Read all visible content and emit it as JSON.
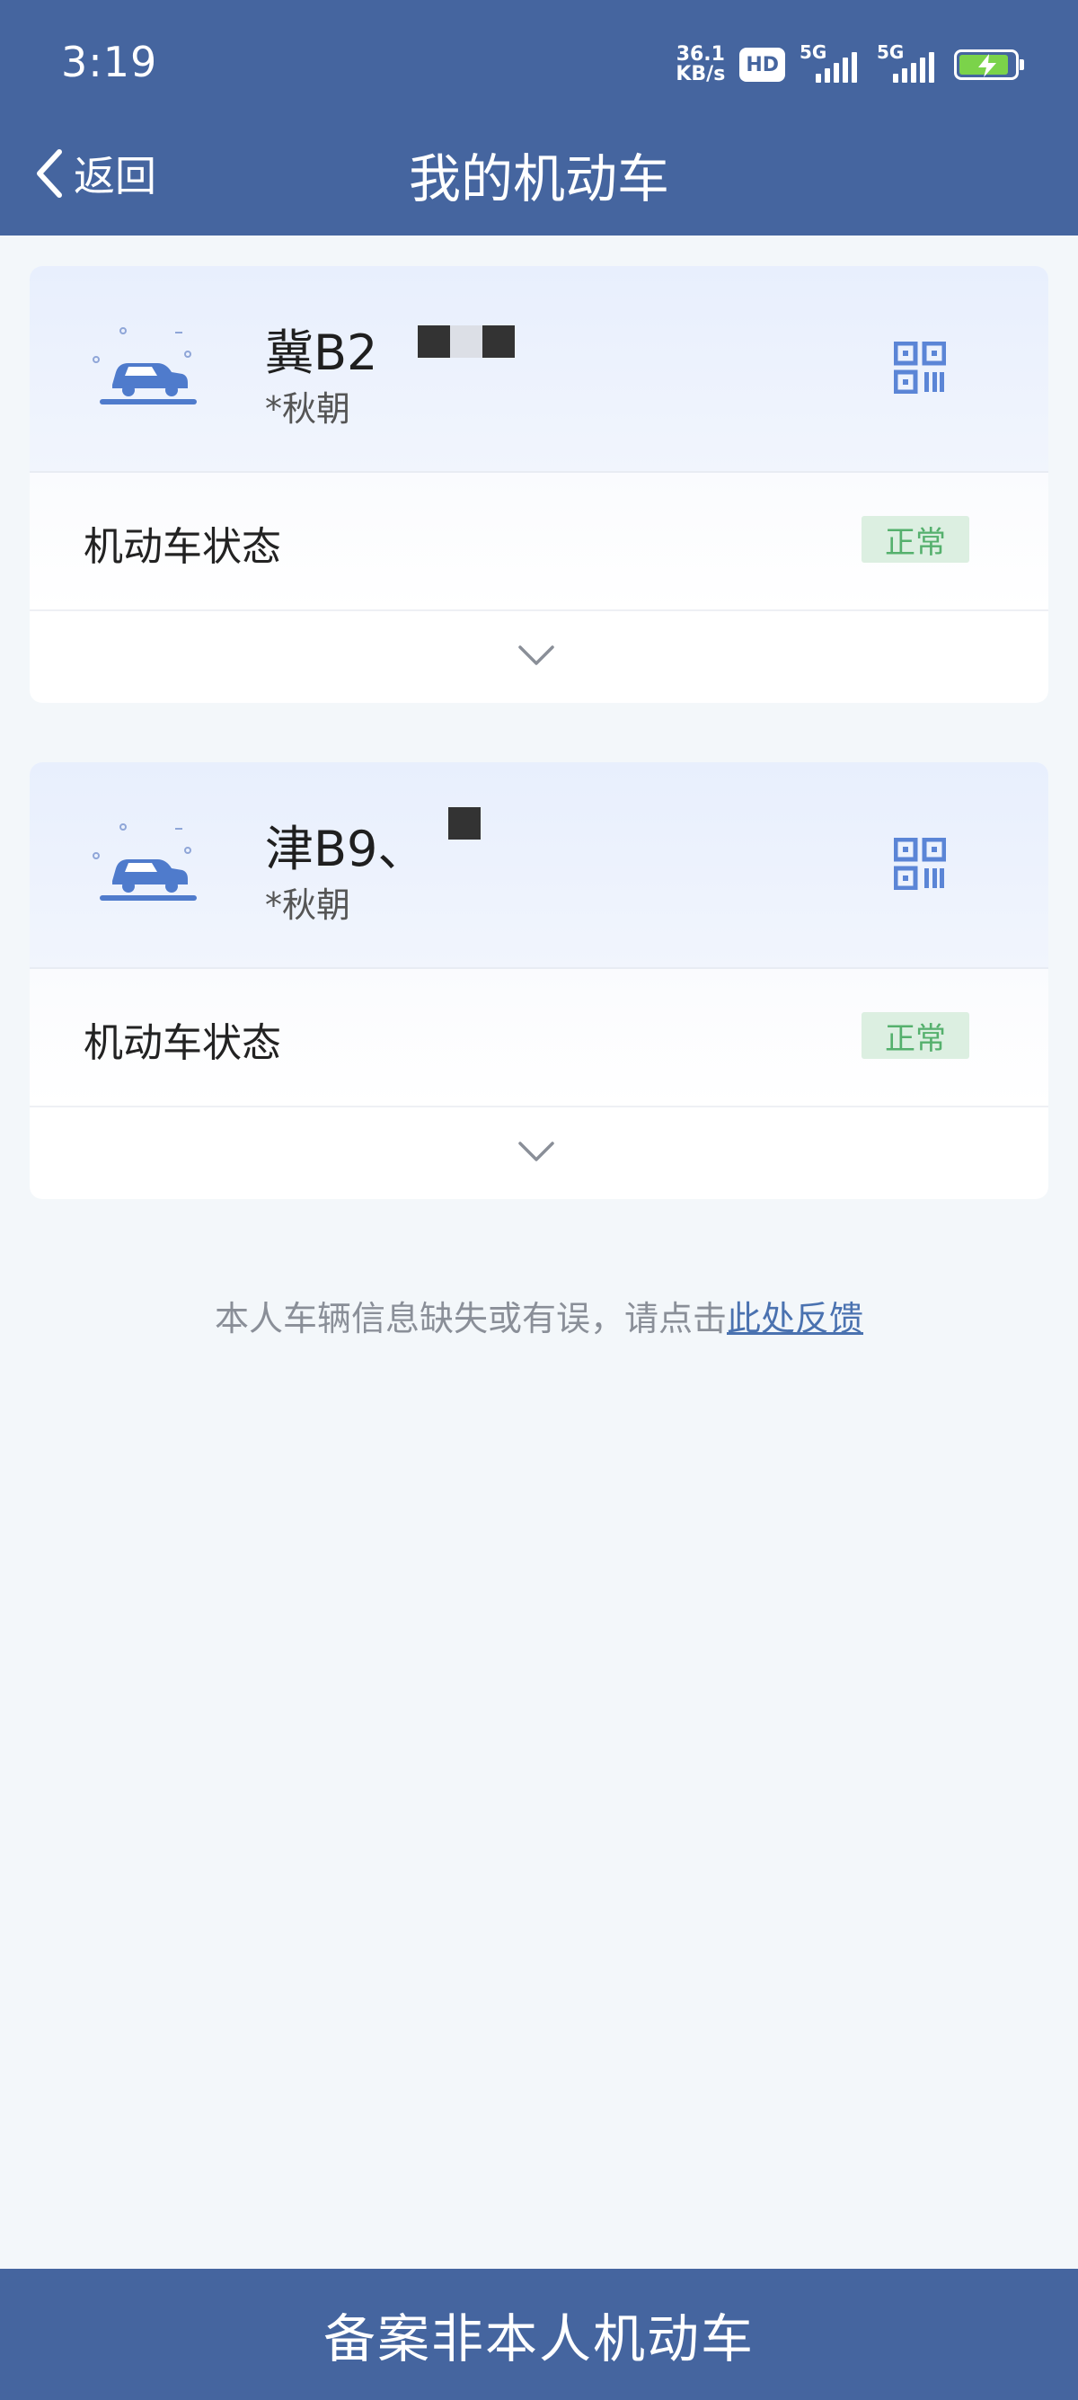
{
  "status_bar": {
    "time": "3:19",
    "net_speed_value": "36.1",
    "net_speed_unit": "KB/s",
    "hd_label": "HD",
    "signal1_label": "5G",
    "signal2_label": "5G",
    "battery_level": 0.9
  },
  "nav": {
    "back_label": "返回",
    "title": "我的机动车"
  },
  "vehicles": [
    {
      "plate": "冀B2",
      "owner": "*秋朝",
      "status_label": "机动车状态",
      "status_value": "正常"
    },
    {
      "plate": "津B9、",
      "owner": "*秋朝",
      "status_label": "机动车状态",
      "status_value": "正常"
    }
  ],
  "feedback": {
    "text": "本人车辆信息缺失或有误，请点击",
    "link": "此处反馈"
  },
  "bottom_action": {
    "label": "备案非本人机动车"
  },
  "colors": {
    "primary": "#45659f",
    "accent_blue": "#5b85d6",
    "status_ok_bg": "#dcefe1",
    "status_ok_text": "#55b06d",
    "link": "#4a72b0"
  }
}
